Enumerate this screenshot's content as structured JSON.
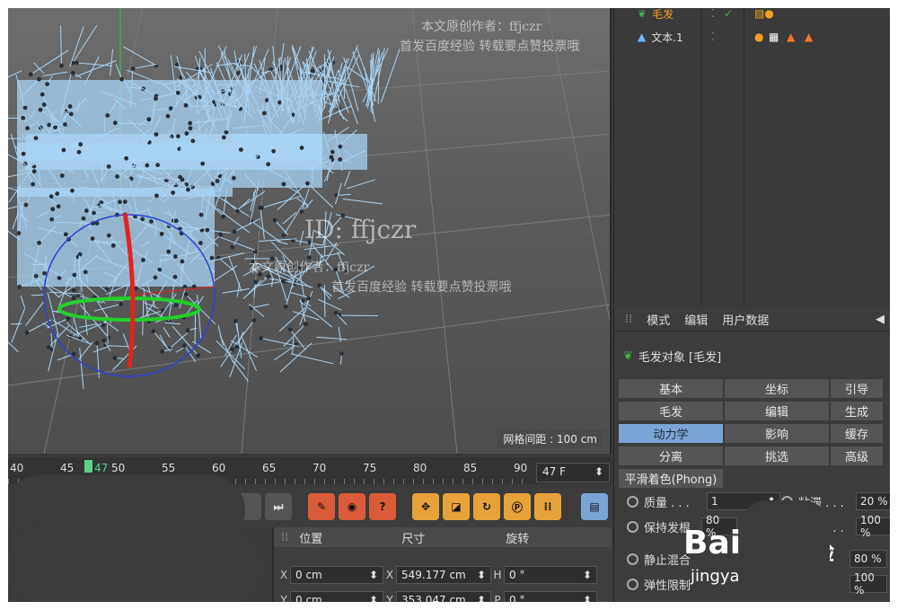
{
  "viewport": {
    "grid_spacing": "网格间距 : 100 cm"
  },
  "timeline": {
    "ticks": [
      "40",
      "45",
      "47",
      "50",
      "55",
      "60",
      "65",
      "70",
      "75",
      "80",
      "85",
      "90"
    ],
    "current_frame": "47 F"
  },
  "coords": {
    "headers": [
      "位置",
      "尺寸",
      "旋转"
    ],
    "rows": [
      {
        "axis": "X",
        "pos": "0 cm",
        "size_axis": "X",
        "size": "549.177 cm",
        "rot_axis": "H",
        "rot": "0 °"
      },
      {
        "axis": "Y",
        "pos": "0 cm",
        "size_axis": "Y",
        "size": "353.047 cm",
        "rot_axis": "P",
        "rot": "0 °"
      }
    ]
  },
  "object_manager": {
    "objects": [
      {
        "name": "毛发",
        "highlight": true
      },
      {
        "name": "文本.1",
        "highlight": false
      }
    ]
  },
  "attributes": {
    "menu": [
      "模式",
      "编辑",
      "用户数据"
    ],
    "object_title": "毛发对象 [毛发]",
    "tabs": [
      [
        "基本",
        "坐标",
        "引导"
      ],
      [
        "毛发",
        "编辑",
        "生成"
      ],
      [
        "动力学",
        "影响",
        "缓存"
      ],
      [
        "分离",
        "挑选",
        "高级"
      ]
    ],
    "active_tab": "动力学",
    "phong_tab": "平滑着色(Phong)",
    "params": [
      {
        "label": "质量 . . .",
        "value": "1",
        "label2": "粘滞 . . .",
        "value2": "20 %"
      },
      {
        "label": "保持发根",
        "value": "80 %",
        "label2": "硬度 . . .",
        "value2": "100 %"
      },
      {
        "label": "静止混合",
        "value": "",
        "label2": "",
        "value2": "80 %"
      },
      {
        "label": "弹性限制",
        "value": "",
        "label2": "",
        "value2": "100 %"
      }
    ]
  },
  "watermarks": {
    "top_line1": "本文原创作者：ffjczr",
    "top_line2": "首发百度经验 转载要点赞投票哦",
    "center_id": "ID: ffjczr",
    "center_line1": "本文原创作者：ffjczr",
    "center_line2": "首发百度经验 转载要点赞投票哦",
    "baidu_logo": "Bai",
    "baidu_jingyan": "经验",
    "baidu_url": "jingyan"
  },
  "colors": {
    "accent_blue": "#7aa5d6",
    "hair_blue": "#a9d4f5",
    "highlight_orange": "#f3a21f",
    "playhead_green": "#5fd08b"
  }
}
